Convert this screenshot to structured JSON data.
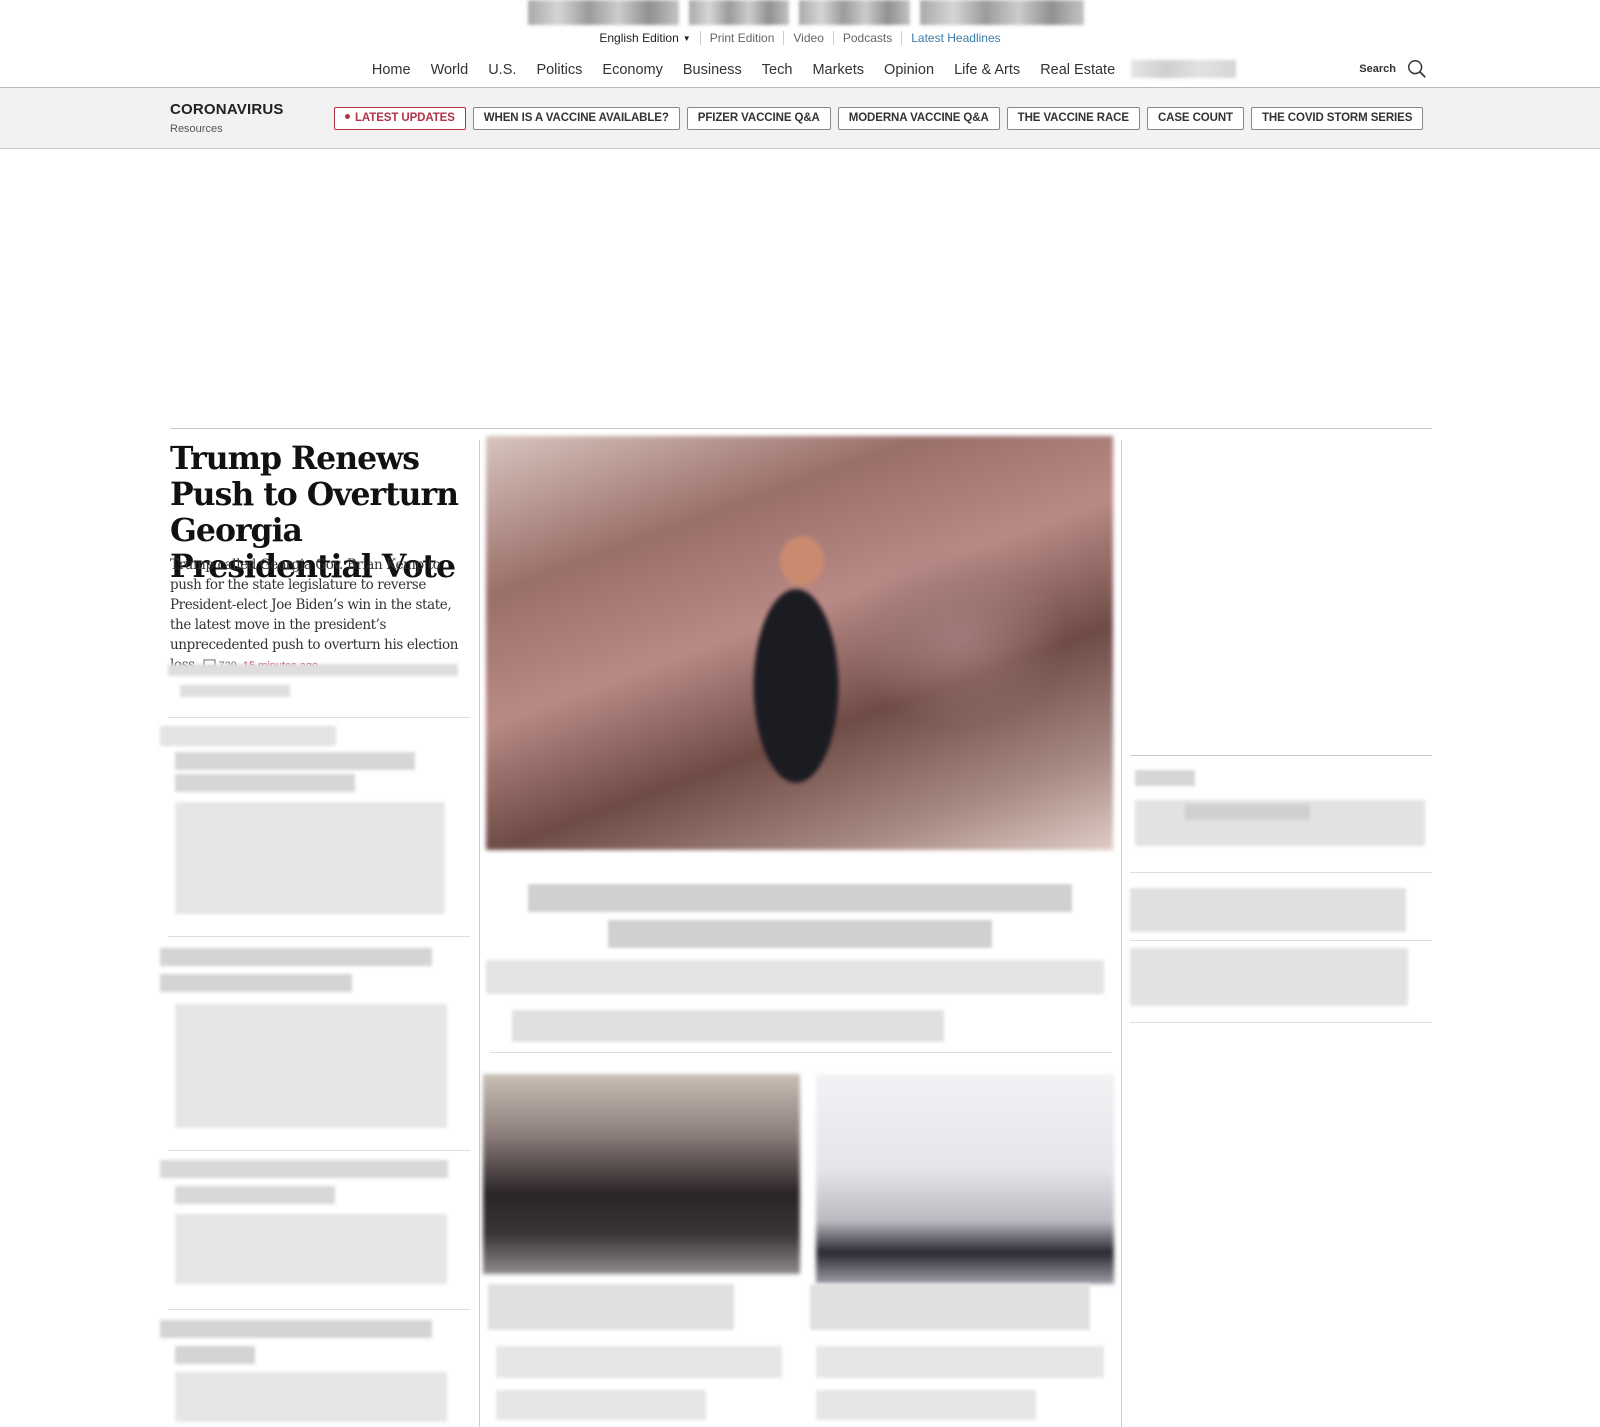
{
  "utility_nav": {
    "edition": "English Edition",
    "links": [
      "Print Edition",
      "Video",
      "Podcasts",
      "Latest Headlines"
    ]
  },
  "main_nav": {
    "items": [
      "Home",
      "World",
      "U.S.",
      "Politics",
      "Economy",
      "Business",
      "Tech",
      "Markets",
      "Opinion",
      "Life & Arts",
      "Real Estate"
    ],
    "search_label": "Search"
  },
  "coronavirus_bar": {
    "title": "CORONAVIRUS",
    "subtitle": "Resources",
    "pills": [
      "LATEST UPDATES",
      "WHEN IS A VACCINE AVAILABLE?",
      "PFIZER VACCINE Q&A",
      "MODERNA VACCINE Q&A",
      "THE VACCINE RACE",
      "CASE COUNT",
      "THE COVID STORM SERIES"
    ]
  },
  "lead_story": {
    "headline": "Trump Renews Push to Overturn Georgia Presidential Vote",
    "summary": "Trump called Georgia Gov. Brian Kemp to push for the state legislature to reverse President-elect Joe Biden’s win in the state, the latest move in the president’s unprecedented push to overturn his election loss.",
    "comment_count": "729",
    "timestamp": "15 minutes ago"
  },
  "colors": {
    "accent_red": "#b23246",
    "link_blue": "#3a7aa8"
  }
}
